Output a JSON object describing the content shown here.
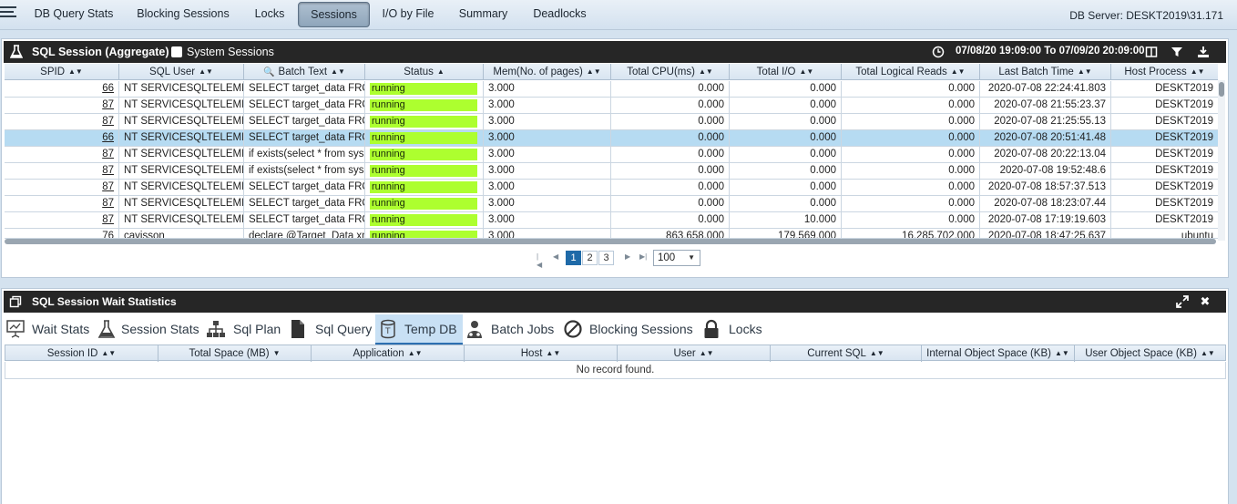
{
  "nav": {
    "tabs": [
      {
        "label": "DB Query Stats"
      },
      {
        "label": "Blocking Sessions"
      },
      {
        "label": "Locks"
      },
      {
        "label": "Sessions"
      },
      {
        "label": "I/O by File"
      },
      {
        "label": "Summary"
      },
      {
        "label": "Deadlocks"
      }
    ],
    "db_server": "DB Server: DESKT2019\\31.171"
  },
  "session_panel": {
    "title": "SQL Session (Aggregate)",
    "system_sessions_label": "System Sessions",
    "time_range": "07/08/20 19:09:00 To 07/09/20 20:09:00",
    "columns": [
      "SPID",
      "SQL User",
      "Batch Text",
      "Status",
      "Mem(No. of pages)",
      "Total CPU(ms)",
      "Total I/O",
      "Total Logical Reads",
      "Last Batch Time",
      "Host Process"
    ],
    "rows": [
      [
        "66",
        "NT SERVICESQLTELEMETRY",
        "SELECT target_data FROM",
        "running",
        "3.000",
        "0.000",
        "0.000",
        "0.000",
        "2020-07-08 22:24:41.803",
        "DESKT2019"
      ],
      [
        "87",
        "NT SERVICESQLTELEMETRY",
        "SELECT target_data FROM",
        "running",
        "3.000",
        "0.000",
        "0.000",
        "0.000",
        "2020-07-08 21:55:23.37",
        "DESKT2019"
      ],
      [
        "87",
        "NT SERVICESQLTELEMETRY",
        "SELECT target_data FROM",
        "running",
        "3.000",
        "0.000",
        "0.000",
        "0.000",
        "2020-07-08 21:25:55.13",
        "DESKT2019"
      ],
      [
        "66",
        "NT SERVICESQLTELEMETRY",
        "SELECT target_data FROM",
        "running",
        "3.000",
        "0.000",
        "0.000",
        "0.000",
        "2020-07-08 20:51:41.48",
        "DESKT2019"
      ],
      [
        "87",
        "NT SERVICESQLTELEMETRY",
        "if exists(select * from sys.",
        "running",
        "3.000",
        "0.000",
        "0.000",
        "0.000",
        "2020-07-08 20:22:13.04",
        "DESKT2019"
      ],
      [
        "87",
        "NT SERVICESQLTELEMETRY",
        "if exists(select * from sys.",
        "running",
        "3.000",
        "0.000",
        "0.000",
        "0.000",
        "2020-07-08 19:52:48.6",
        "DESKT2019"
      ],
      [
        "87",
        "NT SERVICESQLTELEMETRY",
        "SELECT target_data FROM",
        "running",
        "3.000",
        "0.000",
        "0.000",
        "0.000",
        "2020-07-08 18:57:37.513",
        "DESKT2019"
      ],
      [
        "87",
        "NT SERVICESQLTELEMETRY",
        "SELECT target_data FROM",
        "running",
        "3.000",
        "0.000",
        "0.000",
        "0.000",
        "2020-07-08 18:23:07.44",
        "DESKT2019"
      ],
      [
        "87",
        "NT SERVICESQLTELEMETRY",
        "SELECT target_data FROM",
        "running",
        "3.000",
        "0.000",
        "10.000",
        "0.000",
        "2020-07-08 17:19:19.603",
        "DESKT2019"
      ],
      [
        "76",
        "cavisson",
        "declare @Target_Data xml",
        "running",
        "3.000",
        "863,658.000",
        "179,569.000",
        "16,285,702.000",
        "2020-07-08 18:47:25.637",
        "ubuntu"
      ]
    ],
    "selected_row": 3,
    "status_color": "#adff2f",
    "pager": {
      "pages": [
        "1",
        "2",
        "3"
      ],
      "current": "1",
      "page_size": "100"
    }
  },
  "wait_panel": {
    "title": "SQL Session Wait Statistics",
    "tabs": [
      {
        "label": "Wait Stats",
        "icon": "presentation-icon"
      },
      {
        "label": "Session Stats",
        "icon": "flask-icon"
      },
      {
        "label": "Sql Plan",
        "icon": "sitemap-icon"
      },
      {
        "label": "Sql Query",
        "icon": "file-icon"
      },
      {
        "label": "Temp DB",
        "icon": "database-icon"
      },
      {
        "label": "Batch Jobs",
        "icon": "users-icon"
      },
      {
        "label": "Blocking Sessions",
        "icon": "ban-icon"
      },
      {
        "label": "Locks",
        "icon": "lock-icon"
      }
    ],
    "active_tab": "Temp DB",
    "columns": [
      "Session ID",
      "Total Space (MB)",
      "Application",
      "Host",
      "User",
      "Current SQL",
      "Internal Object Space (KB)",
      "User Object Space (KB)"
    ],
    "empty_message": "No record found."
  }
}
